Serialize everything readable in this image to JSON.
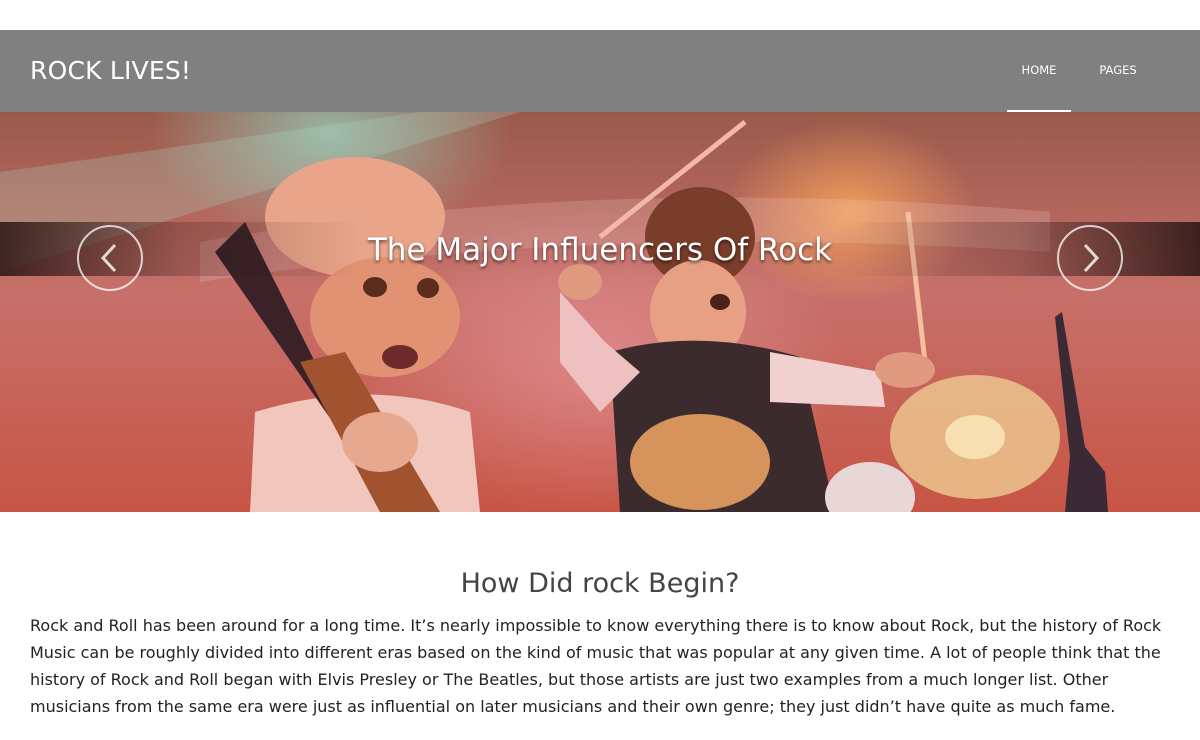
{
  "header": {
    "brand": "ROCK LIVES!",
    "nav": [
      {
        "label": "HOME",
        "active": true
      },
      {
        "label": "PAGES",
        "active": false
      }
    ]
  },
  "hero": {
    "title": "The Major Influencers Of Rock",
    "prev_icon": "chevron-left-icon",
    "next_icon": "chevron-right-icon"
  },
  "content": {
    "heading": "How Did rock Begin?",
    "paragraph": "Rock and Roll has been around for a long time. It’s nearly impossible to know everything there is to know about Rock, but the history of Rock Music can be roughly divided into different eras based on the kind of music that was popular at any given time. A lot of people think that the history of Rock and Roll began with Elvis Presley or The Beatles, but those artists are just two examples from a much longer list. Other musicians from the same era were just as influential on later musicians and their own genre; they just didn’t have quite as much fame."
  },
  "colors": {
    "header_bg": "#808080",
    "text": "#222222"
  }
}
